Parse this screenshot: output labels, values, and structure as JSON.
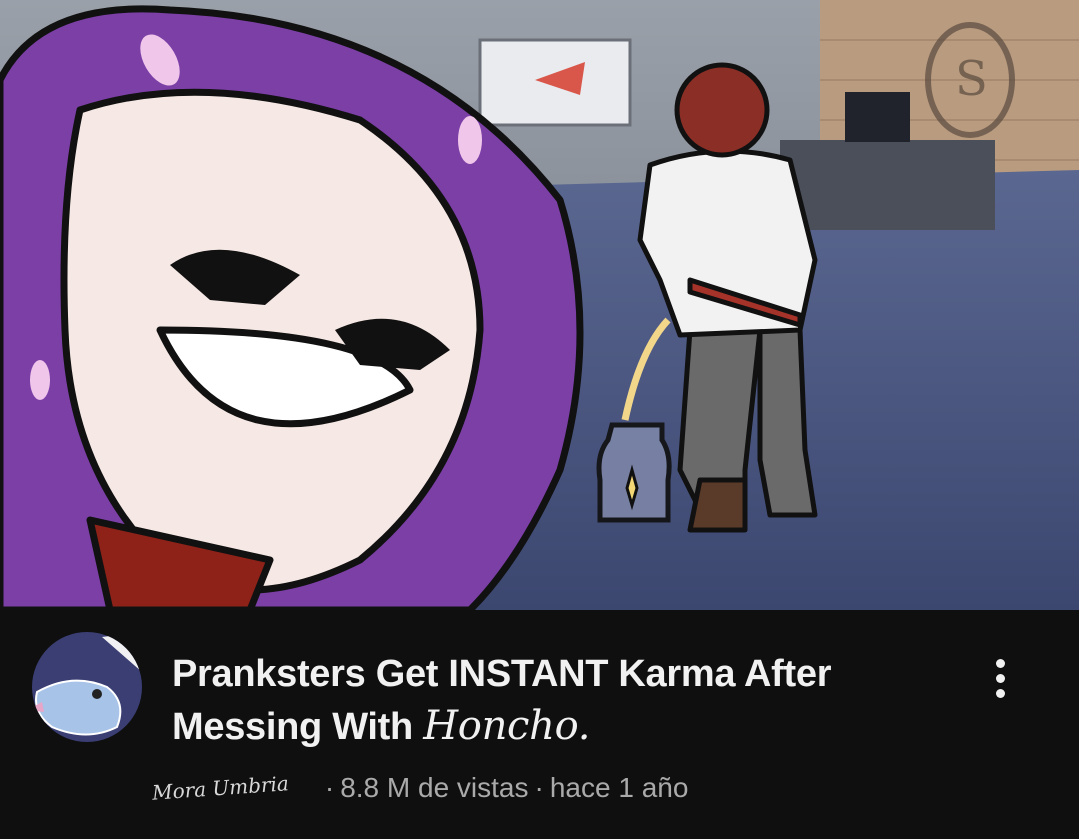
{
  "video": {
    "title_main": "Pranksters Get INSTANT Karma After Messing With",
    "title_handwritten": "Honcho.",
    "channel_name": "Mora Umbria",
    "views": "8.8 M de vistas",
    "age": "hace 1 año",
    "separator": "·"
  },
  "icons": {
    "menu": "more-vert-icon",
    "avatar": "channel-avatar-bird"
  },
  "colors": {
    "background": "#0f0f0f",
    "title_text": "#f1f1f1",
    "meta_text": "#aaaaaa",
    "hair_purple": "#7b3fa6",
    "floor_blue": "#4b5a86"
  }
}
